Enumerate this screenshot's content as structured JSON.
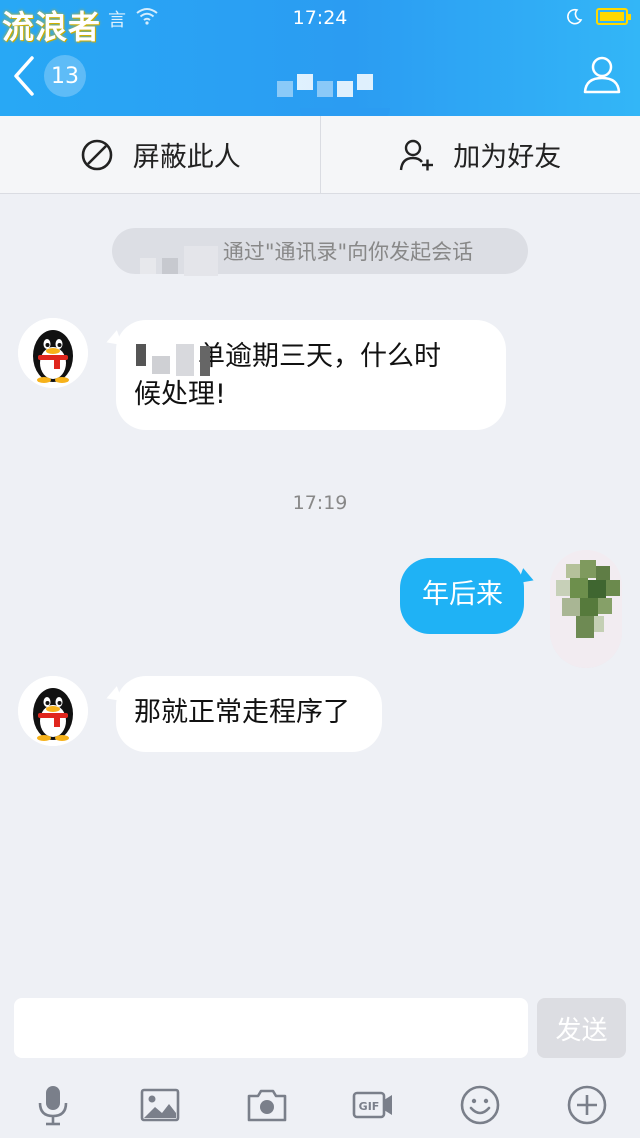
{
  "status_bar": {
    "watermark": "流浪者",
    "carrier": "言",
    "time": "17:24"
  },
  "header": {
    "unread_count": "13",
    "profile_icon": "person-icon"
  },
  "actions": {
    "block_label": "屏蔽此人",
    "add_friend_label": "加为好友"
  },
  "chat": {
    "system_notice": "通过\"通讯录\"向你发起会话",
    "timestamp": "17:19",
    "messages": [
      {
        "side": "left",
        "text_line1": "单逾期三天，什么时",
        "text_line2": "候处理!"
      },
      {
        "side": "right",
        "text": "年后来"
      },
      {
        "side": "left",
        "text": "那就正常走程序了"
      }
    ]
  },
  "input": {
    "value": "",
    "placeholder": "",
    "send_label": "发送"
  },
  "toolbar": {
    "icons": [
      "microphone-icon",
      "image-icon",
      "camera-icon",
      "gif-icon",
      "emoji-icon",
      "plus-icon"
    ]
  },
  "colors": {
    "header_blue": "#2b9cf2",
    "bubble_blue": "#1fb2f5",
    "background": "#eef0f5"
  }
}
